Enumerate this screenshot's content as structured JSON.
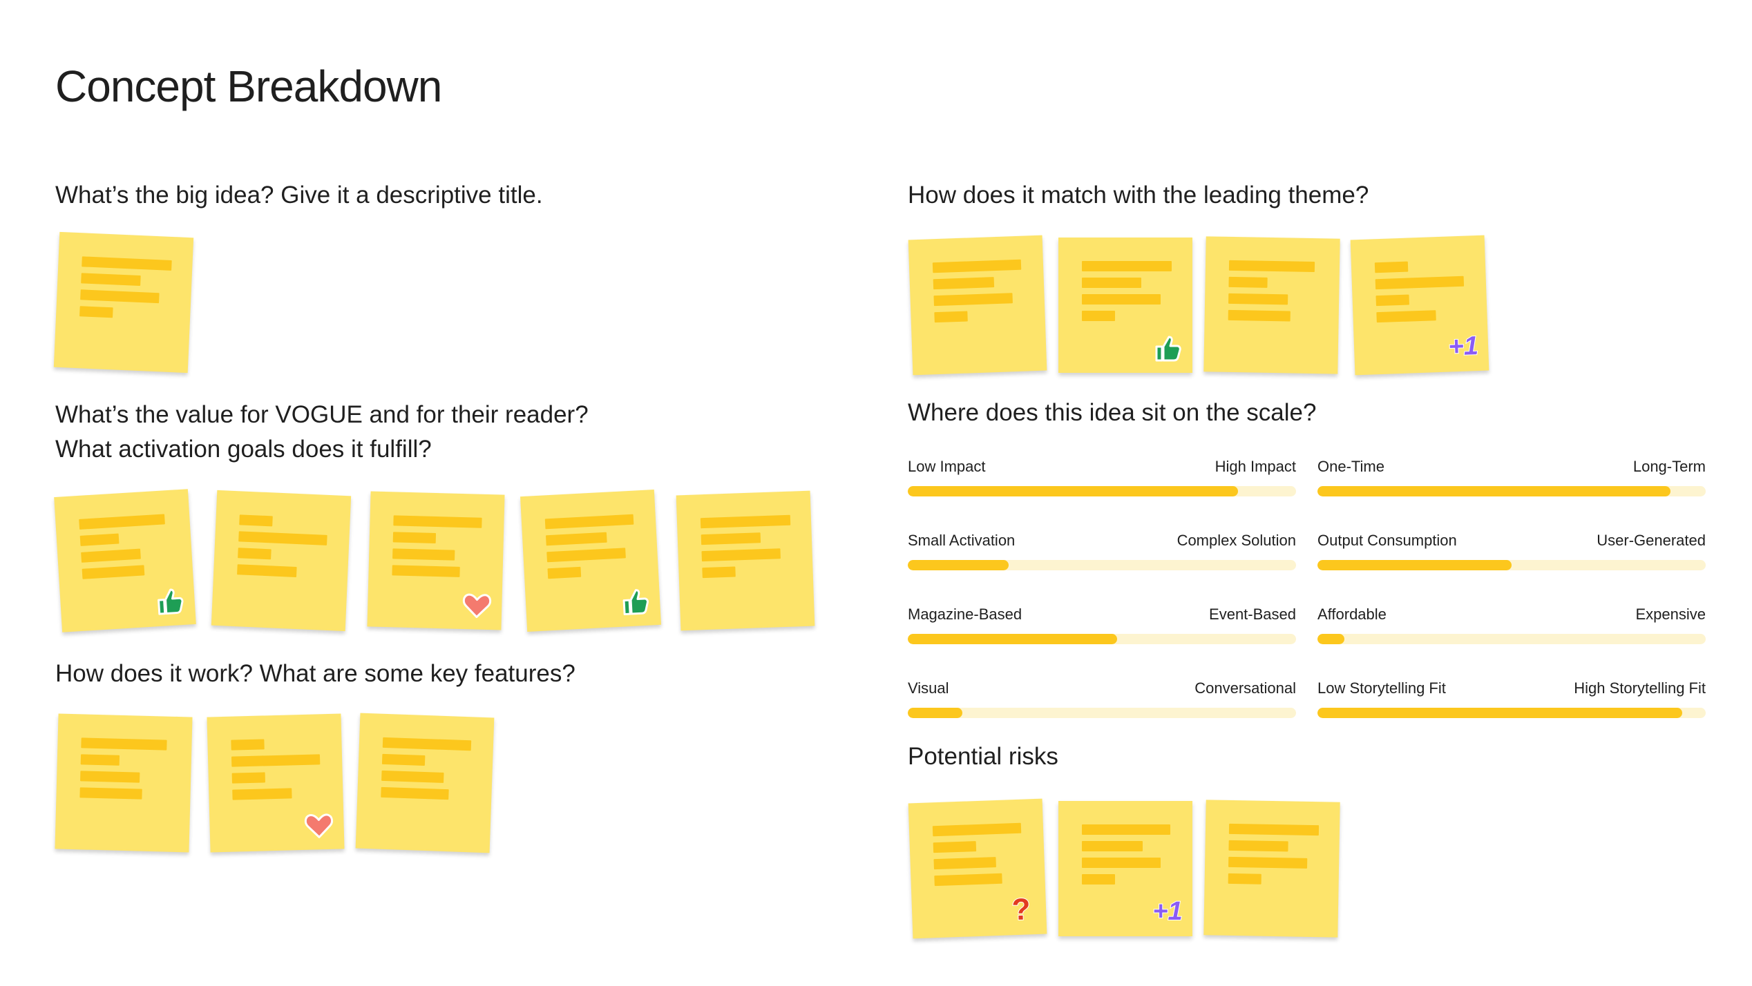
{
  "page_title": "Concept Breakdown",
  "sections": {
    "big_idea": {
      "question": "What’s the big idea? Give it a descriptive title."
    },
    "value": {
      "question_line1": "What’s the value for VOGUE and for their reader?",
      "question_line2": "What activation goals does it fulfill?"
    },
    "features": {
      "question": "How does it work? What are some key features?"
    },
    "theme": {
      "question": "How does it match with the leading theme?"
    },
    "scale": {
      "question": "Where does this idea sit on the scale?"
    },
    "risks": {
      "question": "Potential risks"
    }
  },
  "sticky_notes": {
    "big_idea": [
      {
        "reaction": "none"
      }
    ],
    "value": [
      {
        "reaction": "thumbs-up-icon"
      },
      {
        "reaction": "none"
      },
      {
        "reaction": "heart-icon"
      },
      {
        "reaction": "thumbs-up-icon"
      },
      {
        "reaction": "none"
      }
    ],
    "features": [
      {
        "reaction": "none"
      },
      {
        "reaction": "heart-icon"
      },
      {
        "reaction": "none"
      }
    ],
    "theme": [
      {
        "reaction": "none"
      },
      {
        "reaction": "thumbs-up-icon"
      },
      {
        "reaction": "none"
      },
      {
        "reaction": "plus-one-icon"
      }
    ],
    "risks": [
      {
        "reaction": "question-mark-icon"
      },
      {
        "reaction": "plus-one-icon"
      },
      {
        "reaction": "none"
      }
    ]
  },
  "stickers": {
    "plus_one": "+1",
    "question": "?"
  },
  "scales": [
    {
      "left": "Low Impact",
      "right": "High Impact",
      "value": 0.85
    },
    {
      "left": "One-Time",
      "right": "Long-Term",
      "value": 0.91
    },
    {
      "left": "Small Activation",
      "right": "Complex Solution",
      "value": 0.26
    },
    {
      "left": "Output Consumption",
      "right": "User-Generated",
      "value": 0.5
    },
    {
      "left": "Magazine-Based",
      "right": "Event-Based",
      "value": 0.54
    },
    {
      "left": "Affordable",
      "right": "Expensive",
      "value": 0.07
    },
    {
      "left": "Visual",
      "right": "Conversational",
      "value": 0.14
    },
    {
      "left": "Low Storytelling Fit",
      "right": "High Storytelling Fit",
      "value": 0.94
    }
  ],
  "colors": {
    "note": "#fde46b",
    "note_bar": "#fcc71d",
    "track": "#fdf4d0",
    "fill": "#fcc71d",
    "thumbs": "#1e9e55",
    "heart": "#f47a6e",
    "plus_one": "#8a5cf5",
    "question": "#e23b21"
  }
}
